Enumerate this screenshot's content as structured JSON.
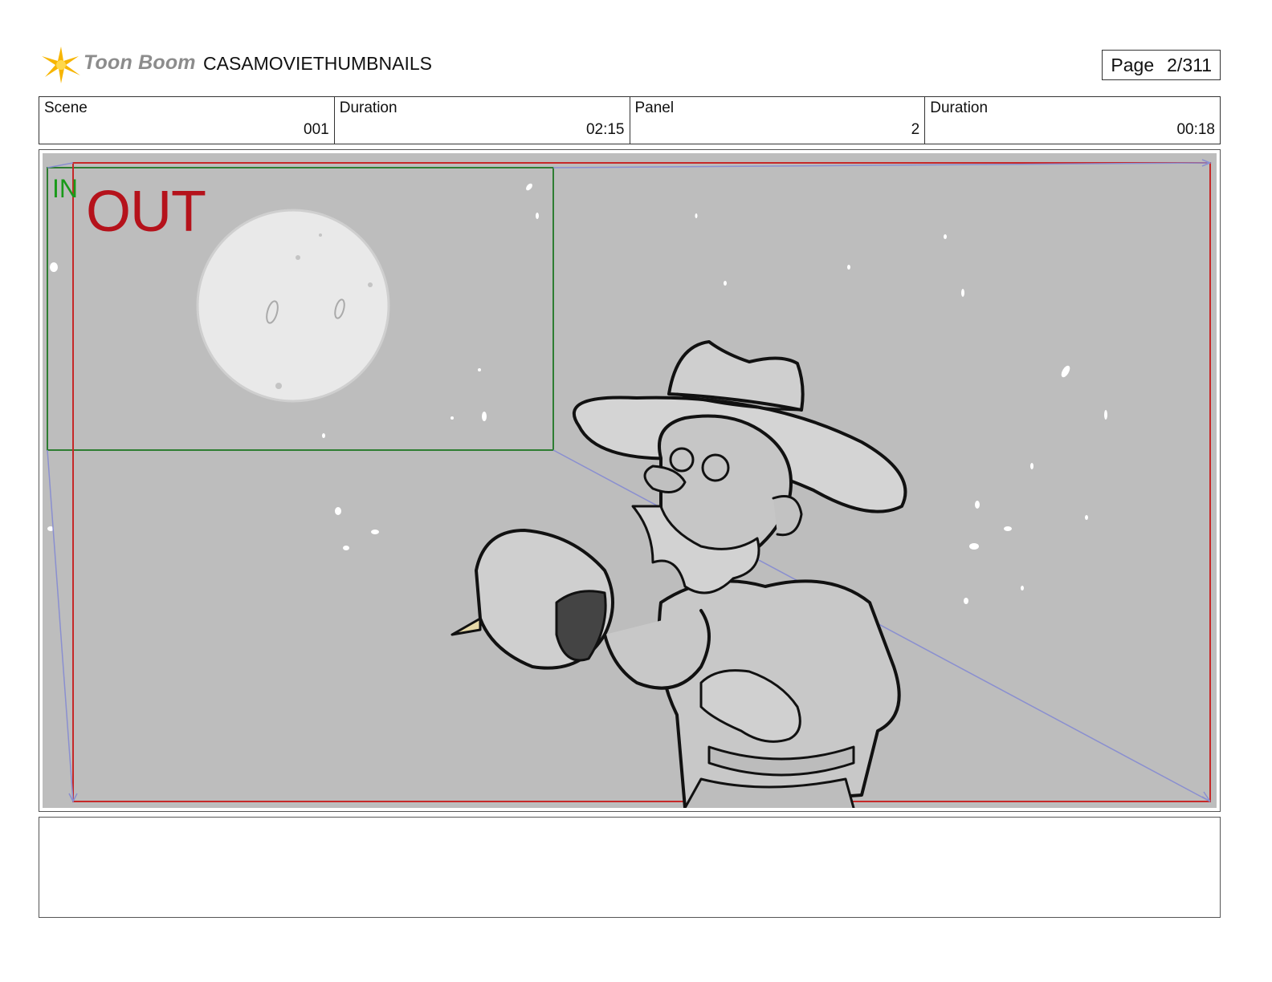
{
  "header": {
    "logo_text": "Toon Boom",
    "project_title": "CASAMOVIETHUMBNAILS",
    "page_label": "Page",
    "page_value": "2/311"
  },
  "info": {
    "scene_label": "Scene",
    "scene_value": "001",
    "scene_duration_label": "Duration",
    "scene_duration_value": "02:15",
    "panel_label": "Panel",
    "panel_value": "2",
    "panel_duration_label": "Duration",
    "panel_duration_value": "00:18"
  },
  "panel": {
    "in_label": "IN",
    "out_label": "OUT",
    "colors": {
      "background": "#bdbdbd",
      "in_frame": "#2e7d32",
      "out_frame": "#c62828",
      "motion_path": "#8a8fd0"
    }
  },
  "notes": {
    "text": ""
  }
}
